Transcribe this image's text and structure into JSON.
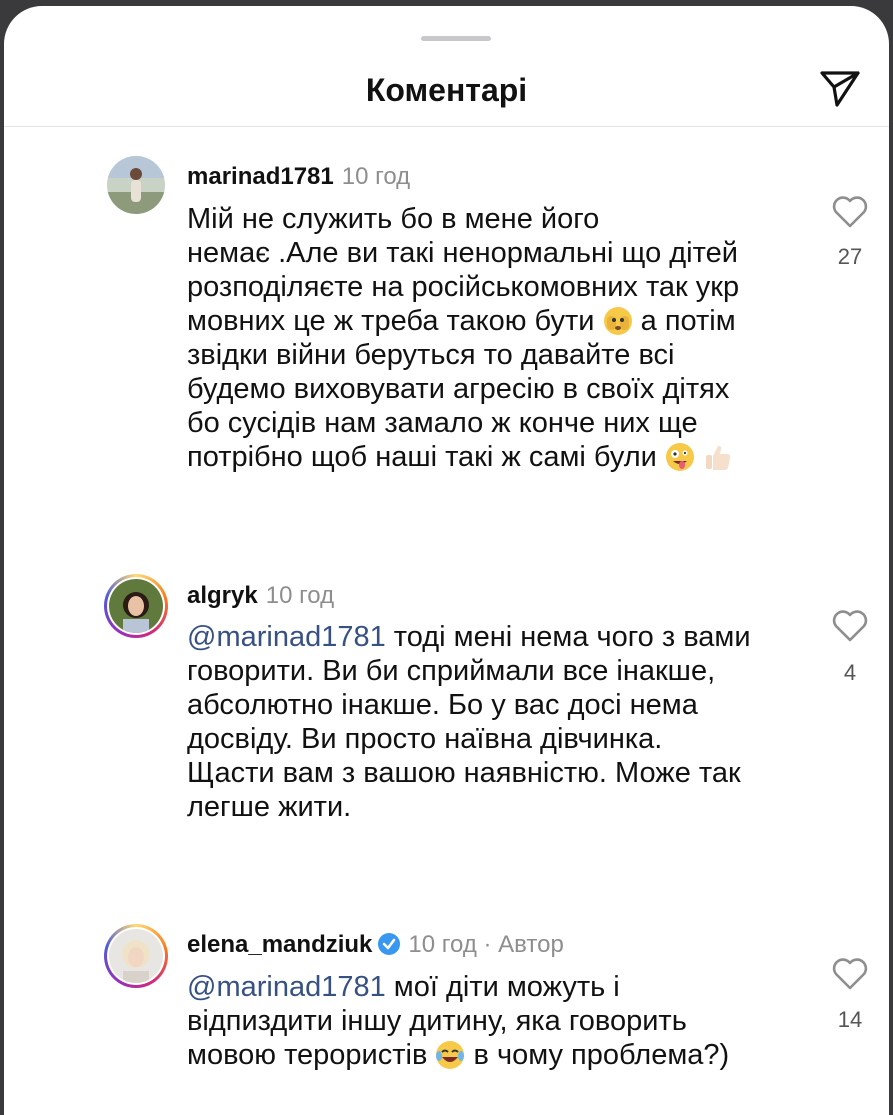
{
  "header": {
    "title": "Коментарі"
  },
  "comments": [
    {
      "username": "marinad1781",
      "time": "10 год",
      "lines": [
        "Мій не служить бо в мене його",
        "немає .Але ви такі ненормальні що дітей",
        "розподіляєте на російськомовних так укр",
        "мовних це ж треба такою бути",
        "а потім",
        "звідки війни беруться то давайте всі",
        "будемо виховувати агресію в своїх дітях",
        "бо сусідів нам замало ж конче них ще",
        "потрібно щоб наші такі ж самі були"
      ],
      "likes": "27"
    },
    {
      "username": "algryk",
      "time": "10 год",
      "mention": "@marinad1781",
      "lines": [
        " тоді мені нема чого з вами",
        "говорити. Ви би сприймали все інакше,",
        "абсолютно інакше. Бо у вас досі нема",
        "досвіду. Ви просто наївна дівчинка.",
        "Щасти вам з вашою наявністю. Може так",
        "легше жити."
      ],
      "likes": "4"
    },
    {
      "username": "elena_mandziuk",
      "time": "10 год · ",
      "author": "Автор",
      "mention": "@marinad1781",
      "lines": [
        " мої діти можуть і",
        "відпиздити іншу дитину, яка говорить",
        "мовою терористів",
        " в чому проблема?)"
      ],
      "likes": "14"
    }
  ]
}
